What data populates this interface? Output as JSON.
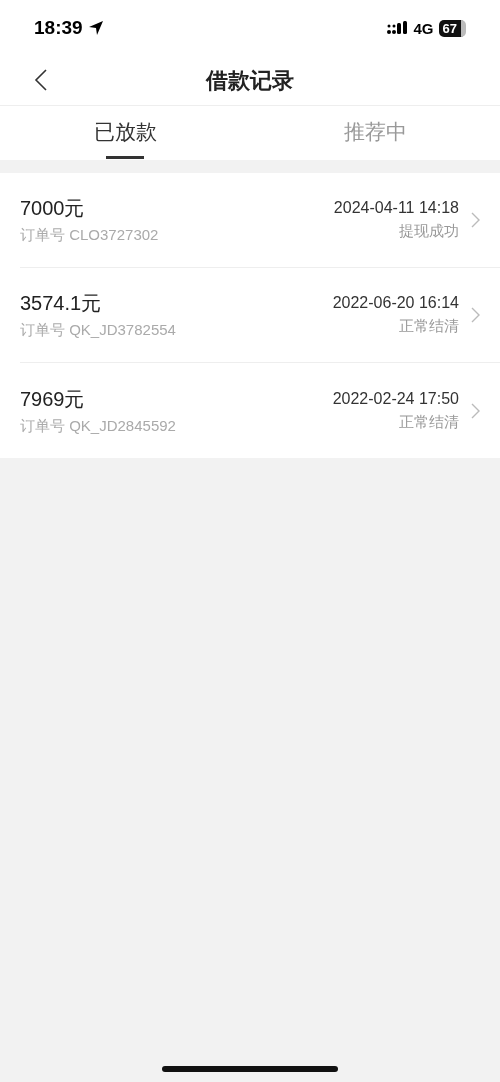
{
  "status_bar": {
    "time": "18:39",
    "network": "4G",
    "battery": "67"
  },
  "nav": {
    "title": "借款记录"
  },
  "tabs": [
    {
      "label": "已放款",
      "selected": true
    },
    {
      "label": "推荐中",
      "selected": false
    }
  ],
  "records": [
    {
      "amount": "7000元",
      "order": "订单号 CLO3727302",
      "time": "2024-04-11 14:18",
      "status": "提现成功"
    },
    {
      "amount": "3574.1元",
      "order": "订单号 QK_JD3782554",
      "time": "2022-06-20 16:14",
      "status": "正常结清"
    },
    {
      "amount": "7969元",
      "order": "订单号 QK_JD2845592",
      "time": "2022-02-24 17:50",
      "status": "正常结清"
    }
  ]
}
